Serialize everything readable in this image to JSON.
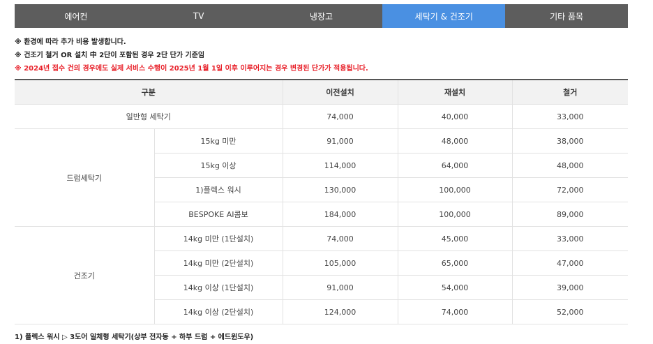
{
  "tabs": [
    {
      "label": "에어컨",
      "active": false
    },
    {
      "label": "TV",
      "active": false
    },
    {
      "label": "냉장고",
      "active": false
    },
    {
      "label": "세탁기 & 건조기",
      "active": true
    },
    {
      "label": "기타 품목",
      "active": false
    }
  ],
  "notes": [
    "※ 환경에 따라 추가 비용 발생합니다.",
    "※ 건조기 철거 OR 설치 中 2단이 포함된 경우 2단 단가 기준임",
    "※ 2024년 접수 건의 경우에도 실제 서비스 수행이 2025년 1월 1일 이후 이루어지는 경우 변경된 단가가 적용됩니다."
  ],
  "table": {
    "headers": [
      "구분",
      "이전설치",
      "재설치",
      "철거"
    ],
    "general": {
      "label": "일반형 세탁기",
      "move": "74,000",
      "reinstall": "40,000",
      "remove": "33,000"
    },
    "groups": [
      {
        "name": "드럼세탁기",
        "rows": [
          {
            "label": "15kg 미만",
            "move": "91,000",
            "reinstall": "48,000",
            "remove": "38,000"
          },
          {
            "label": "15kg 이상",
            "move": "114,000",
            "reinstall": "64,000",
            "remove": "48,000"
          },
          {
            "label": "1)플렉스 워시",
            "move": "130,000",
            "reinstall": "100,000",
            "remove": "72,000"
          },
          {
            "label": "BESPOKE AI콤보",
            "move": "184,000",
            "reinstall": "100,000",
            "remove": "89,000"
          }
        ]
      },
      {
        "name": "건조기",
        "rows": [
          {
            "label": "14kg 미만 (1단설치)",
            "move": "74,000",
            "reinstall": "45,000",
            "remove": "33,000"
          },
          {
            "label": "14kg 미만 (2단설치)",
            "move": "105,000",
            "reinstall": "65,000",
            "remove": "47,000"
          },
          {
            "label": "14kg 이상 (1단설치)",
            "move": "91,000",
            "reinstall": "54,000",
            "remove": "39,000"
          },
          {
            "label": "14kg 이상 (2단설치)",
            "move": "124,000",
            "reinstall": "74,000",
            "remove": "52,000"
          }
        ]
      }
    ]
  },
  "footnote": "1) 플렉스 워시 ▷ 3도어 일체형 세탁기(상부 전자동 + 하부 드럼 + 에드윈도우)"
}
